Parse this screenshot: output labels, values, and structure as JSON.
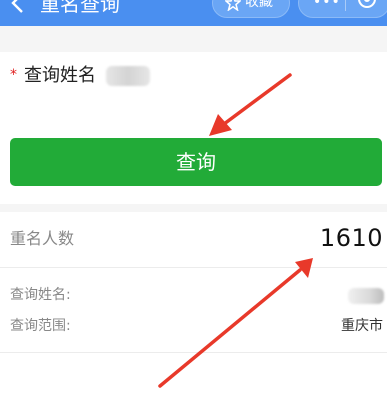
{
  "header": {
    "title": "重名查询",
    "fav_label": "收藏",
    "more_glyph": "•••"
  },
  "form": {
    "required_mark": "*",
    "name_label": "查询姓名",
    "name_value": ""
  },
  "query_button": {
    "label": "查询",
    "color": "#22ab38"
  },
  "result": {
    "count_label": "重名人数",
    "count_value": "1610",
    "name_label": "查询姓名:",
    "range_label": "查询范围:",
    "range_value": "重庆市"
  },
  "colors": {
    "header_bg": "#4a8ff0",
    "arrow_red": "#e8392a",
    "required_red": "#e02020"
  }
}
